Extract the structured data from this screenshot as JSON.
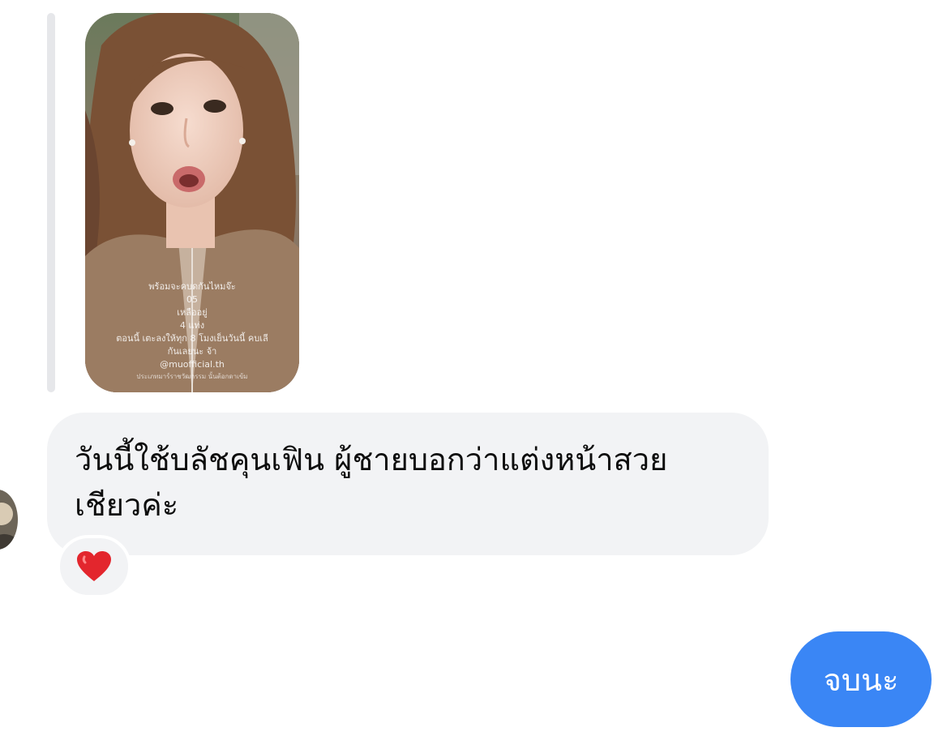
{
  "story": {
    "caption_lines": [
      "พร้อมจะคบดกันไหมจ๊ะ",
      "05",
      "เหลืออยู่",
      "4 แท่ง",
      "ตอนนี้ เตะลงให้ทุก 8 โมงเย็นวันนี้ คบเลี",
      "กันเลยนะ จ้า"
    ],
    "handle": "@muofficial.th",
    "fine_print": "ประเภทมาร์ราชวัฒกรรม นั้นต้อกดาเข้ม"
  },
  "messages": {
    "incoming": {
      "line1": "วันนี้ใช้บลัชคุนเฟิน ผู้ชายบอกว่าแต่งหน้าสวย",
      "line2": "เชียวค่ะ",
      "reaction": "heart-emoji"
    },
    "outgoing": {
      "text": "จบนะ",
      "color": "#3a86f5"
    }
  },
  "colors": {
    "incoming_bubble": "#f2f3f5",
    "reply_bar": "#e6e7ea",
    "heart": "#e3262d"
  }
}
